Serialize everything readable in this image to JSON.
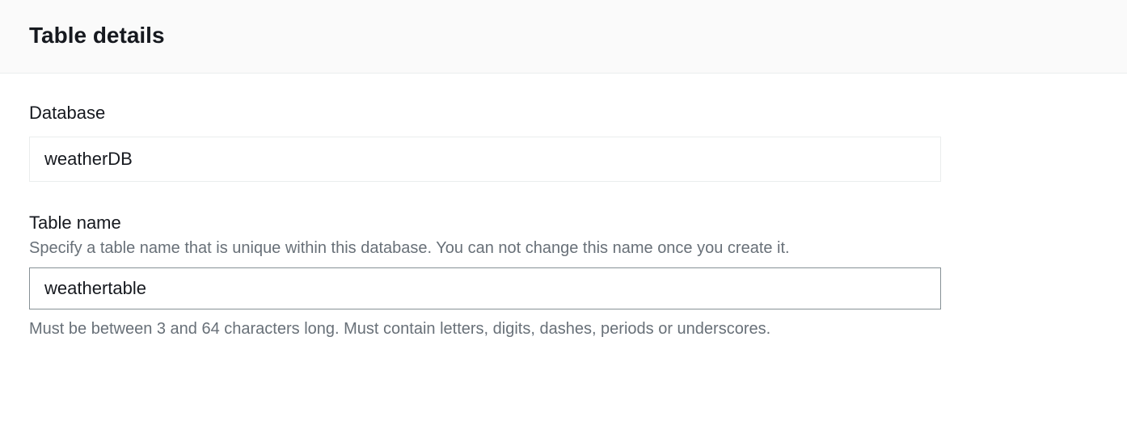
{
  "header": {
    "title": "Table details"
  },
  "form": {
    "database": {
      "label": "Database",
      "value": "weatherDB"
    },
    "tableName": {
      "label": "Table name",
      "description": "Specify a table name that is unique within this database. You can not change this name once you create it.",
      "value": "weathertable",
      "hint": "Must be between 3 and 64 characters long. Must contain letters, digits, dashes, periods or underscores."
    }
  }
}
